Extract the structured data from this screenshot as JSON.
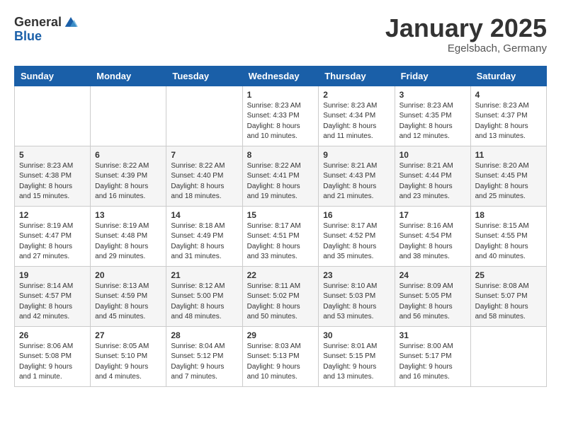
{
  "logo": {
    "general": "General",
    "blue": "Blue"
  },
  "title": "January 2025",
  "location": "Egelsbach, Germany",
  "days_header": [
    "Sunday",
    "Monday",
    "Tuesday",
    "Wednesday",
    "Thursday",
    "Friday",
    "Saturday"
  ],
  "weeks": [
    [
      {
        "day": "",
        "info": ""
      },
      {
        "day": "",
        "info": ""
      },
      {
        "day": "",
        "info": ""
      },
      {
        "day": "1",
        "info": "Sunrise: 8:23 AM\nSunset: 4:33 PM\nDaylight: 8 hours\nand 10 minutes."
      },
      {
        "day": "2",
        "info": "Sunrise: 8:23 AM\nSunset: 4:34 PM\nDaylight: 8 hours\nand 11 minutes."
      },
      {
        "day": "3",
        "info": "Sunrise: 8:23 AM\nSunset: 4:35 PM\nDaylight: 8 hours\nand 12 minutes."
      },
      {
        "day": "4",
        "info": "Sunrise: 8:23 AM\nSunset: 4:37 PM\nDaylight: 8 hours\nand 13 minutes."
      }
    ],
    [
      {
        "day": "5",
        "info": "Sunrise: 8:23 AM\nSunset: 4:38 PM\nDaylight: 8 hours\nand 15 minutes."
      },
      {
        "day": "6",
        "info": "Sunrise: 8:22 AM\nSunset: 4:39 PM\nDaylight: 8 hours\nand 16 minutes."
      },
      {
        "day": "7",
        "info": "Sunrise: 8:22 AM\nSunset: 4:40 PM\nDaylight: 8 hours\nand 18 minutes."
      },
      {
        "day": "8",
        "info": "Sunrise: 8:22 AM\nSunset: 4:41 PM\nDaylight: 8 hours\nand 19 minutes."
      },
      {
        "day": "9",
        "info": "Sunrise: 8:21 AM\nSunset: 4:43 PM\nDaylight: 8 hours\nand 21 minutes."
      },
      {
        "day": "10",
        "info": "Sunrise: 8:21 AM\nSunset: 4:44 PM\nDaylight: 8 hours\nand 23 minutes."
      },
      {
        "day": "11",
        "info": "Sunrise: 8:20 AM\nSunset: 4:45 PM\nDaylight: 8 hours\nand 25 minutes."
      }
    ],
    [
      {
        "day": "12",
        "info": "Sunrise: 8:19 AM\nSunset: 4:47 PM\nDaylight: 8 hours\nand 27 minutes."
      },
      {
        "day": "13",
        "info": "Sunrise: 8:19 AM\nSunset: 4:48 PM\nDaylight: 8 hours\nand 29 minutes."
      },
      {
        "day": "14",
        "info": "Sunrise: 8:18 AM\nSunset: 4:49 PM\nDaylight: 8 hours\nand 31 minutes."
      },
      {
        "day": "15",
        "info": "Sunrise: 8:17 AM\nSunset: 4:51 PM\nDaylight: 8 hours\nand 33 minutes."
      },
      {
        "day": "16",
        "info": "Sunrise: 8:17 AM\nSunset: 4:52 PM\nDaylight: 8 hours\nand 35 minutes."
      },
      {
        "day": "17",
        "info": "Sunrise: 8:16 AM\nSunset: 4:54 PM\nDaylight: 8 hours\nand 38 minutes."
      },
      {
        "day": "18",
        "info": "Sunrise: 8:15 AM\nSunset: 4:55 PM\nDaylight: 8 hours\nand 40 minutes."
      }
    ],
    [
      {
        "day": "19",
        "info": "Sunrise: 8:14 AM\nSunset: 4:57 PM\nDaylight: 8 hours\nand 42 minutes."
      },
      {
        "day": "20",
        "info": "Sunrise: 8:13 AM\nSunset: 4:59 PM\nDaylight: 8 hours\nand 45 minutes."
      },
      {
        "day": "21",
        "info": "Sunrise: 8:12 AM\nSunset: 5:00 PM\nDaylight: 8 hours\nand 48 minutes."
      },
      {
        "day": "22",
        "info": "Sunrise: 8:11 AM\nSunset: 5:02 PM\nDaylight: 8 hours\nand 50 minutes."
      },
      {
        "day": "23",
        "info": "Sunrise: 8:10 AM\nSunset: 5:03 PM\nDaylight: 8 hours\nand 53 minutes."
      },
      {
        "day": "24",
        "info": "Sunrise: 8:09 AM\nSunset: 5:05 PM\nDaylight: 8 hours\nand 56 minutes."
      },
      {
        "day": "25",
        "info": "Sunrise: 8:08 AM\nSunset: 5:07 PM\nDaylight: 8 hours\nand 58 minutes."
      }
    ],
    [
      {
        "day": "26",
        "info": "Sunrise: 8:06 AM\nSunset: 5:08 PM\nDaylight: 9 hours\nand 1 minute."
      },
      {
        "day": "27",
        "info": "Sunrise: 8:05 AM\nSunset: 5:10 PM\nDaylight: 9 hours\nand 4 minutes."
      },
      {
        "day": "28",
        "info": "Sunrise: 8:04 AM\nSunset: 5:12 PM\nDaylight: 9 hours\nand 7 minutes."
      },
      {
        "day": "29",
        "info": "Sunrise: 8:03 AM\nSunset: 5:13 PM\nDaylight: 9 hours\nand 10 minutes."
      },
      {
        "day": "30",
        "info": "Sunrise: 8:01 AM\nSunset: 5:15 PM\nDaylight: 9 hours\nand 13 minutes."
      },
      {
        "day": "31",
        "info": "Sunrise: 8:00 AM\nSunset: 5:17 PM\nDaylight: 9 hours\nand 16 minutes."
      },
      {
        "day": "",
        "info": ""
      }
    ]
  ]
}
